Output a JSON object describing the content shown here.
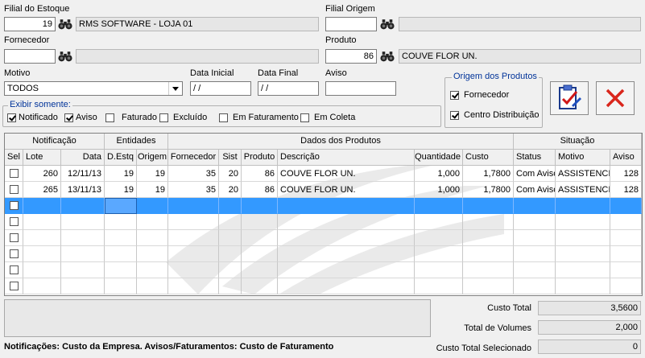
{
  "filial_estoque": {
    "label": "Filial do Estoque",
    "code": "19",
    "name": "RMS SOFTWARE - LOJA 01"
  },
  "filial_origem": {
    "label": "Filial Origem",
    "code": "",
    "name": ""
  },
  "fornecedor": {
    "label": "Fornecedor",
    "code": "",
    "name": ""
  },
  "produto": {
    "label": "Produto",
    "code": "86",
    "name": "COUVE FLOR UN."
  },
  "motivo": {
    "label": "Motivo",
    "value": "TODOS"
  },
  "data_inicial": {
    "label": "Data Inicial",
    "value": " / /"
  },
  "data_final": {
    "label": "Data Final",
    "value": " / /"
  },
  "aviso": {
    "label": "Aviso",
    "value": ""
  },
  "origem": {
    "title": "Origem dos  Produtos",
    "fornecedor": "Fornecedor",
    "centro": "Centro Distribuição"
  },
  "exibir": {
    "title": "Exibir somente:",
    "notificado": "Notificado",
    "aviso": "Aviso",
    "faturado": "Faturado",
    "excluido": "Excluído",
    "em_faturamento": "Em Faturamento",
    "em_coleta": "Em Coleta"
  },
  "grid": {
    "groups": {
      "notificacao": "Notificação",
      "entidades": "Entidades",
      "dados": "Dados dos Produtos",
      "situacao": "Situação"
    },
    "columns": {
      "sel": "Sel",
      "lote": "Lote",
      "data": "Data",
      "destq": "D.Estq",
      "origem": "Origem",
      "fornecedor": "Fornecedor",
      "sist": "Sist",
      "produto": "Produto",
      "descricao": "Descrição",
      "quantidade": "Quantidade",
      "custo": "Custo",
      "status": "Status",
      "motivo": "Motivo",
      "aviso": "Aviso"
    },
    "rows": [
      {
        "lote": "260",
        "data": "12/11/13",
        "destq": "19",
        "origem": "19",
        "fornecedor": "35",
        "sist": "20",
        "produto": "86",
        "descricao": "COUVE FLOR UN.",
        "quantidade": "1,000",
        "custo": "1,7800",
        "status": "Com Aviso",
        "motivo": "ASSISTENCIA",
        "aviso": "128"
      },
      {
        "lote": "265",
        "data": "13/11/13",
        "destq": "19",
        "origem": "19",
        "fornecedor": "35",
        "sist": "20",
        "produto": "86",
        "descricao": "COUVE FLOR UN.",
        "quantidade": "1,000",
        "custo": "1,7800",
        "status": "Com Aviso",
        "motivo": "ASSISTENCIA",
        "aviso": "128"
      }
    ]
  },
  "totais": {
    "custo_total_label": "Custo Total",
    "custo_total": "3,5600",
    "total_volumes_label": "Total de Volumes",
    "total_volumes": "2,000",
    "custo_sel_label": "Custo Total Selecionado",
    "custo_sel": "0"
  },
  "footer": "Notificações: Custo da Empresa. Avisos/Faturamentos: Custo de Faturamento",
  "colors": {
    "selection": "#3399ff",
    "label_blue": "#003399",
    "close_red": "#d9261c"
  }
}
